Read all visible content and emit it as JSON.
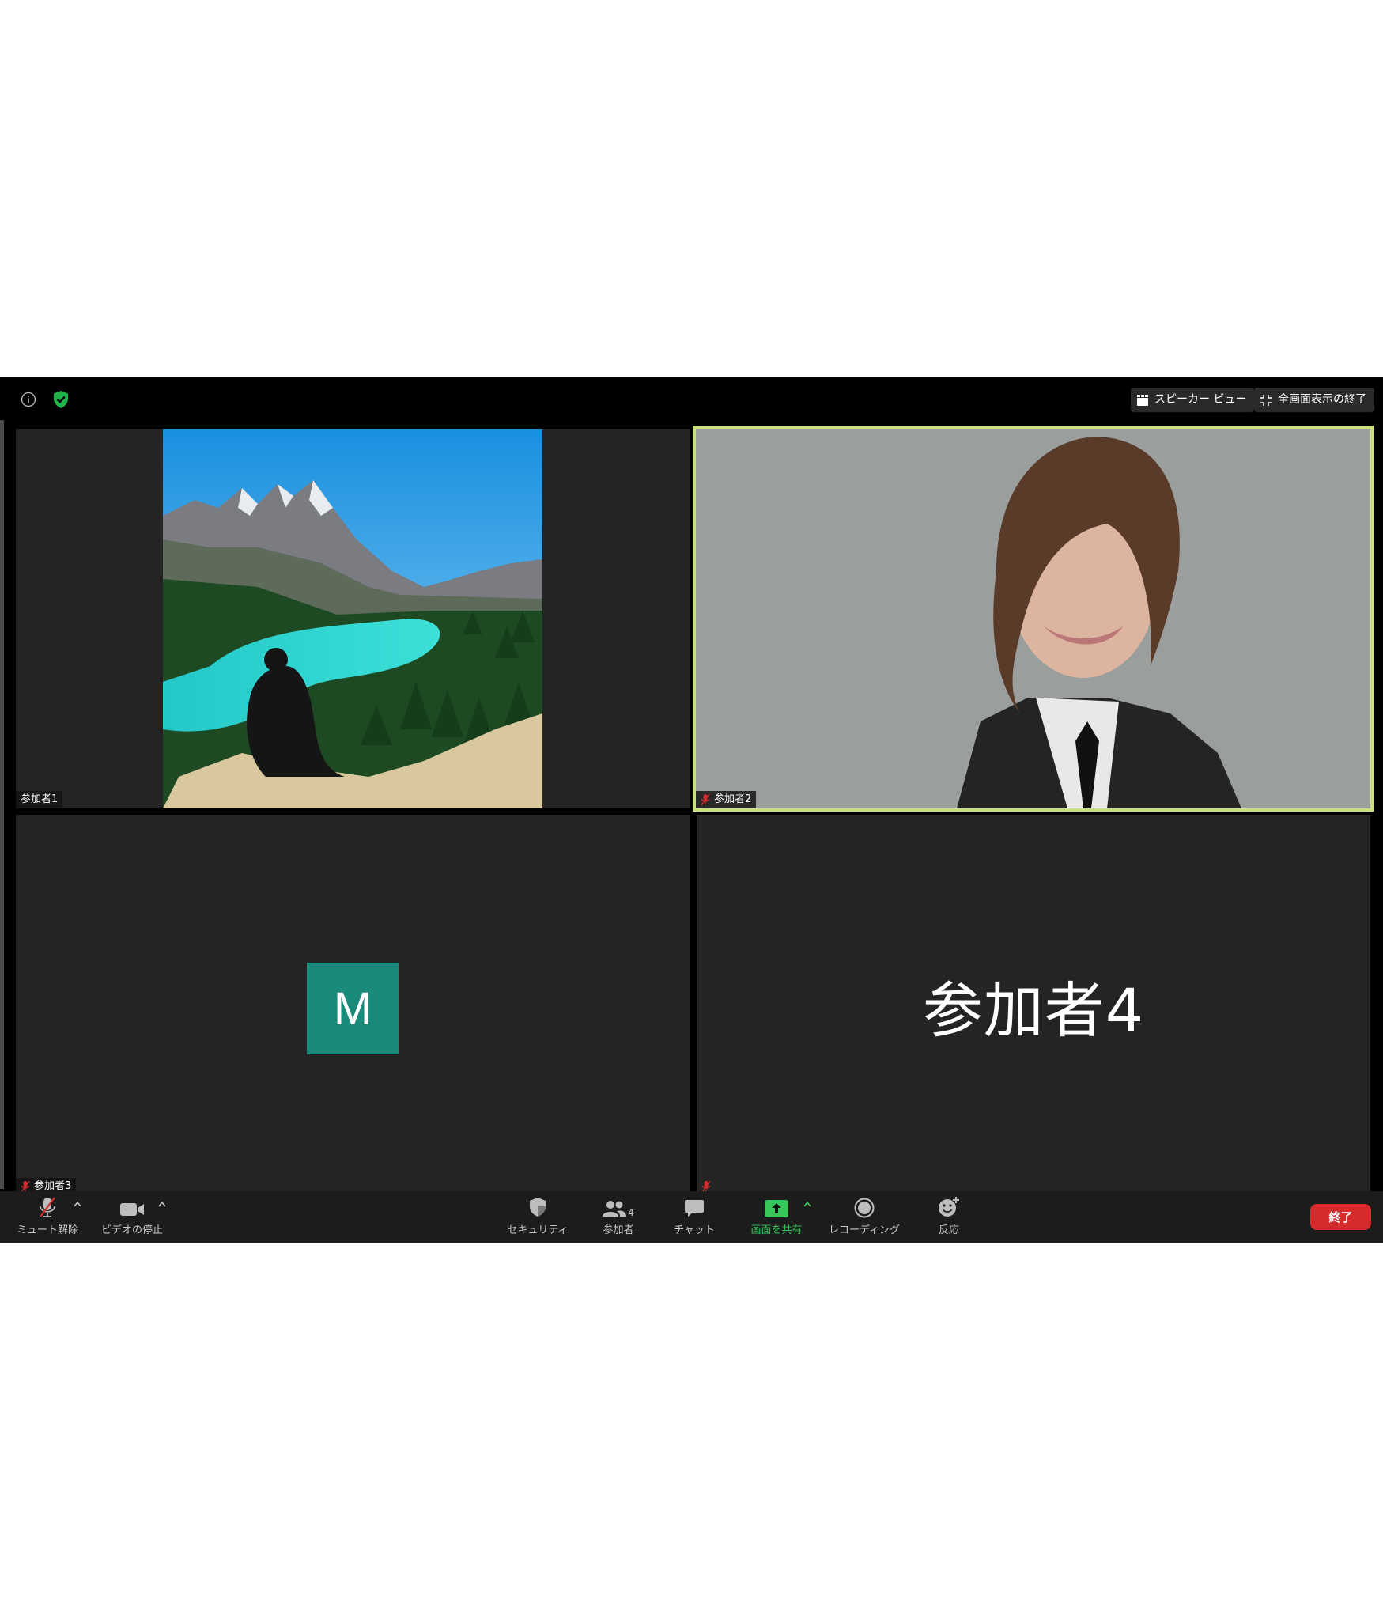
{
  "topbar": {
    "speaker_view_label": "スピーカー ビュー",
    "exit_fullscreen_label": "全画面表示の終了"
  },
  "tiles": [
    {
      "name": "参加者1"
    },
    {
      "name": "参加者2"
    },
    {
      "name": "参加者3",
      "avatar_initial": "M"
    },
    {
      "name": "参加者4",
      "display_name": "参加者4"
    }
  ],
  "toolbar": {
    "unmute_label": "ミュート解除",
    "stop_video_label": "ビデオの停止",
    "security_label": "セキュリティ",
    "participants_label": "参加者",
    "participants_count": "4",
    "chat_label": "チャット",
    "share_screen_label": "画面を共有",
    "recording_label": "レコーディング",
    "reactions_label": "反応",
    "end_label": "終了"
  },
  "colors": {
    "active_speaker_border": "#c9e07f",
    "end_button": "#d42c2c",
    "share_green": "#38c55a",
    "avatar_bg": "#1a8a7a",
    "muted_red": "#d42c2c"
  },
  "icons": [
    "info-icon",
    "shield-check-icon",
    "grid-icon",
    "exit-fullscreen-icon",
    "mic-muted-icon",
    "video-camera-icon",
    "shield-icon",
    "participants-icon",
    "chat-bubble-icon",
    "share-screen-icon",
    "record-icon",
    "reaction-smiley-icon",
    "caret-up-icon"
  ]
}
